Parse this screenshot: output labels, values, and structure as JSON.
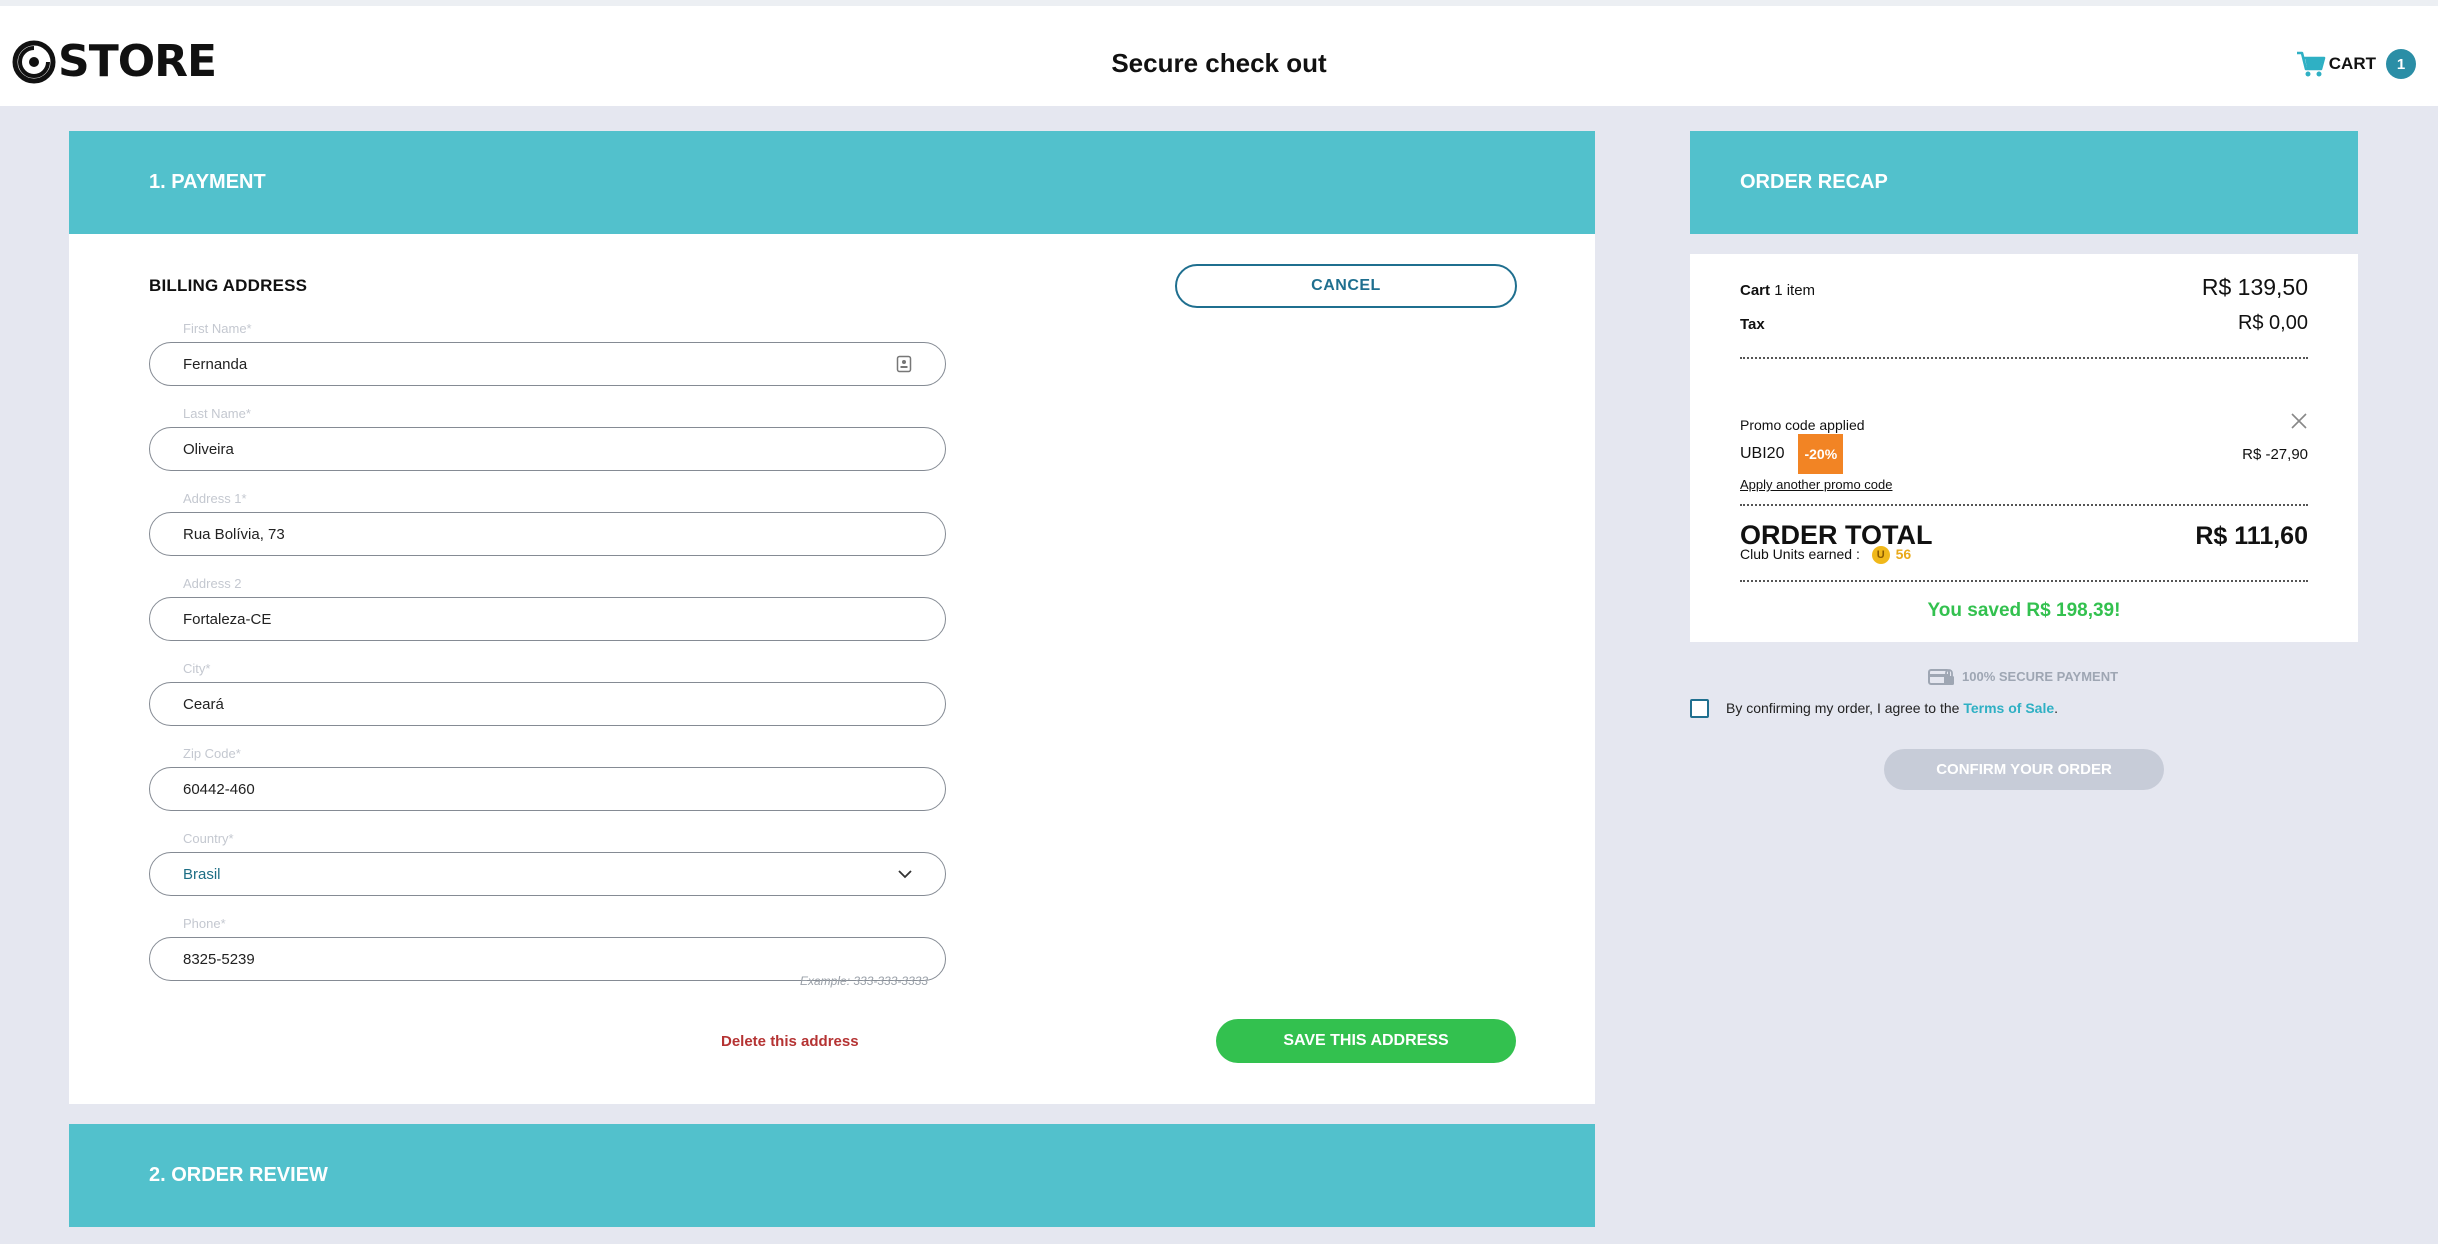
{
  "header": {
    "logo_text": "STORE",
    "title": "Secure check out",
    "cart_label": "CART",
    "cart_count": "1"
  },
  "payment": {
    "heading": "1. PAYMENT",
    "billing_title": "BILLING ADDRESS",
    "cancel_label": "CANCEL",
    "fields": [
      {
        "label": "First Name*",
        "value": "Fernanda"
      },
      {
        "label": "Last Name*",
        "value": "Oliveira"
      },
      {
        "label": "Address 1*",
        "value": "Rua Bolívia, 73"
      },
      {
        "label": "Address 2",
        "value": "Fortaleza-CE"
      },
      {
        "label": "City*",
        "value": "Ceará"
      },
      {
        "label": "Zip Code*",
        "value": "60442-460"
      },
      {
        "label": "Country*",
        "value": "Brasil"
      },
      {
        "label": "Phone*",
        "value": "8325-5239"
      }
    ],
    "phone_hint": "Example: 333-333-3333",
    "delete_label": "Delete this address",
    "save_label": "SAVE THIS ADDRESS"
  },
  "order_review": {
    "heading": "2. ORDER REVIEW"
  },
  "recap": {
    "heading": "ORDER RECAP",
    "cart_label": "Cart",
    "cart_items": "1 item",
    "cart_price": "R$ 139,50",
    "tax_label": "Tax",
    "tax_price": "R$ 0,00",
    "promo_applied": "Promo code applied",
    "promo_code": "UBI20",
    "promo_badge": "-20%",
    "promo_amount": "R$ -27,90",
    "apply_another": "Apply another promo code",
    "total_label": "ORDER TOTAL",
    "total_price": "R$ 111,60",
    "club_units_label": "Club Units earned :",
    "club_coin": "U",
    "club_units_value": "56",
    "saved_text": "You saved R$ 198,39!"
  },
  "secure_text": "100% SECURE PAYMENT",
  "terms": {
    "text": "By confirming my order, I agree to the",
    "link": "Terms of Sale",
    "period": "."
  },
  "confirm_label": "CONFIRM YOUR ORDER",
  "colors": {
    "teal": "#52c1cc",
    "green": "#33c14f",
    "orange": "#f28424",
    "navy": "#1f6f8f",
    "background": "#e5e7f0"
  }
}
